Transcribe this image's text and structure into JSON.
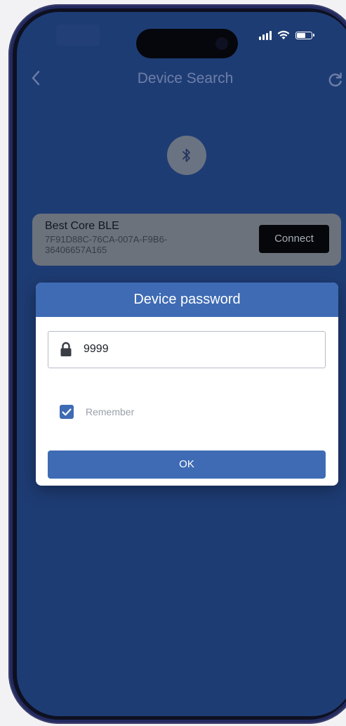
{
  "nav": {
    "title": "Device Search"
  },
  "device": {
    "name": "Best Core BLE",
    "id": "7F91D88C-76CA-007A-F9B6-36406657A165",
    "connect_label": "Connect"
  },
  "dialog": {
    "title": "Device password",
    "password_value": "9999",
    "remember_label": "Remember",
    "remember_checked": true,
    "ok_label": "OK"
  },
  "icons": {
    "back": "chevron-left-icon",
    "refresh": "refresh-icon",
    "bluetooth": "bluetooth-icon",
    "lock": "lock-icon",
    "checkbox": "checkmark-icon"
  },
  "colors": {
    "screen_bg": "#1e3c74",
    "accent": "#3e6bb4",
    "card_bg": "#6c727c",
    "connect_bg": "#06070a"
  }
}
